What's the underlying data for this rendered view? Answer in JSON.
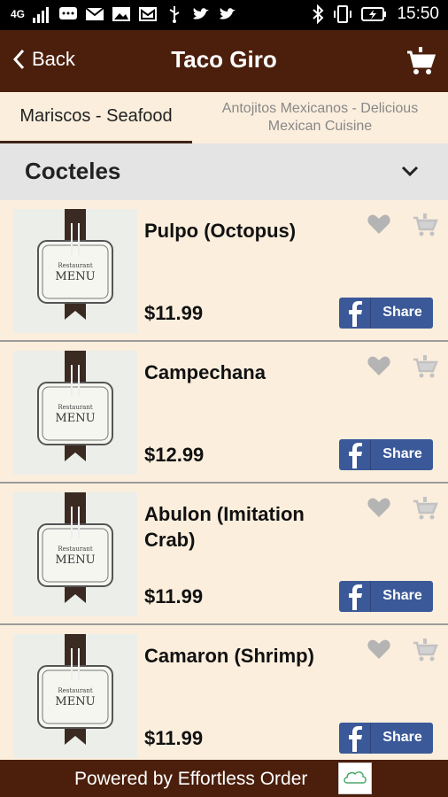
{
  "status_bar": {
    "network": "4G",
    "time": "15:50",
    "icons": [
      "signal-icon",
      "chat-icon",
      "mail-icon",
      "image-icon",
      "gmail-icon",
      "usb-icon",
      "twitter-icon",
      "twitter-icon",
      "bluetooth-icon",
      "vibrate-icon",
      "battery-charging-icon"
    ]
  },
  "header": {
    "back_label": "Back",
    "title": "Taco Giro",
    "cart_icon": "cart-icon"
  },
  "tabs": [
    {
      "label": "Mariscos - Seafood",
      "active": true
    },
    {
      "label": "Antojitos Mexicanos - Delicious Mexican Cuisine",
      "active": false
    }
  ],
  "section": {
    "title": "Cocteles",
    "icon": "chevron-down-icon"
  },
  "items": [
    {
      "name": "Pulpo (Octopus)",
      "price": "$11.99",
      "thumb_title": "Restaurant",
      "thumb_label": "MENU",
      "share_label": "Share"
    },
    {
      "name": "Campechana",
      "price": "$12.99",
      "thumb_title": "Restaurant",
      "thumb_label": "MENU",
      "share_label": "Share"
    },
    {
      "name": "Abulon (Imitation Crab)",
      "price": "$11.99",
      "thumb_title": "Restaurant",
      "thumb_label": "MENU",
      "share_label": "Share"
    },
    {
      "name": "Camaron (Shrimp)",
      "price": "$11.99",
      "thumb_title": "Restaurant",
      "thumb_label": "MENU",
      "share_label": "Share"
    }
  ],
  "footer": {
    "text": "Powered by Effortless Order"
  },
  "colors": {
    "brand_brown": "#4b1f0c",
    "background": "#fbeedd",
    "facebook_blue": "#3b5998",
    "icon_gray": "#b4b4b4"
  }
}
